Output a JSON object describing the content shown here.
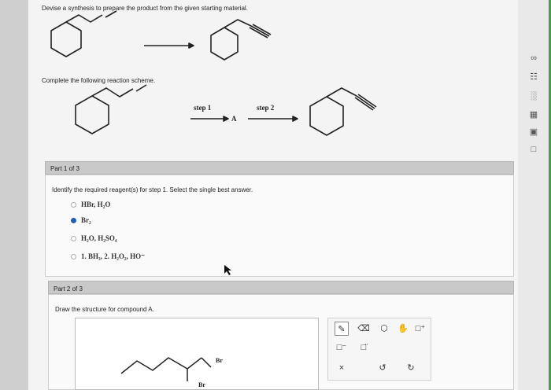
{
  "problem": {
    "prompt": "Devise a synthesis to prepare the product from the given starting material.",
    "scheme_prompt": "Complete the following reaction scheme.",
    "step1_label": "step 1",
    "step2_label": "step 2",
    "intermediate_label": "A"
  },
  "part1": {
    "header": "Part 1 of 3",
    "question": "Identify the required reagent(s) for step 1. Select the single best answer.",
    "options": [
      {
        "label": "HBr, H₂O",
        "selected": false
      },
      {
        "label": "Br₂",
        "selected": true
      },
      {
        "label": "H₂O, H₂SO₄",
        "selected": false
      },
      {
        "label": "1. BH₃, 2. H₂O₂, HO⁻",
        "selected": false
      }
    ]
  },
  "part2": {
    "header": "Part 2 of 3",
    "question": "Draw the structure for compound A.",
    "drawing_labels": {
      "br_top": "Br",
      "br_bottom": "Br"
    }
  },
  "tools": {
    "row1": [
      "pencil-icon",
      "eraser-icon",
      "hand-icon",
      "ring-icon"
    ],
    "row2": [
      "charge-icon",
      "lone-pair-icon"
    ],
    "row3": [
      "clear-icon",
      "undo-icon",
      "redo-icon"
    ],
    "glyphs": {
      "charge": "□⁻",
      "lone_pair": "□̈",
      "clear": "×",
      "undo": "↺",
      "redo": "↻",
      "ring": "□⁺"
    }
  },
  "rail": {
    "glyphs": [
      "∞",
      "☷",
      "░",
      "▦",
      "▣",
      "□"
    ]
  }
}
